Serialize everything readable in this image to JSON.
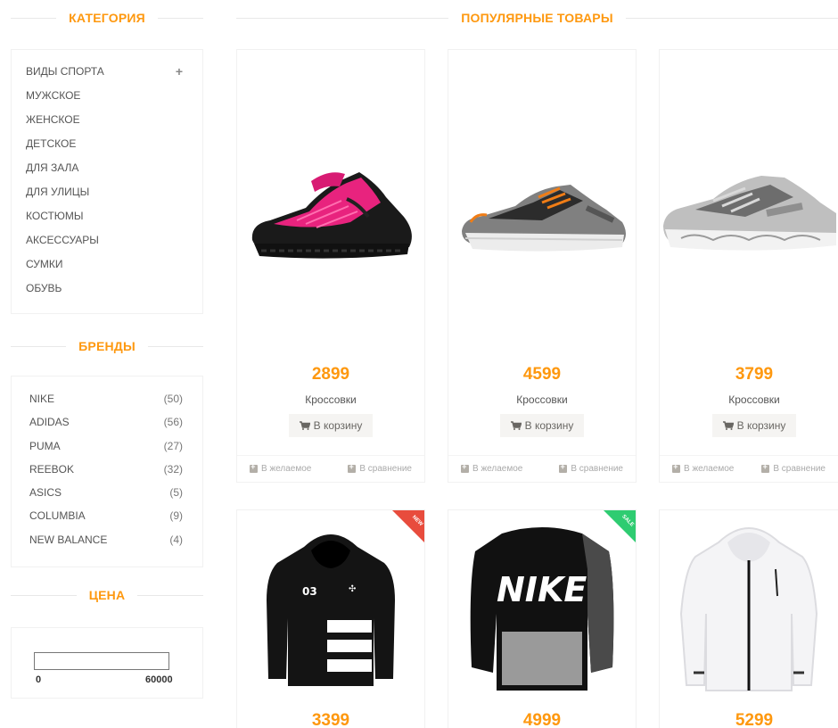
{
  "sidebar": {
    "category_title": "КАТЕГОРИЯ",
    "categories": [
      "ВИДЫ СПОРТА",
      "МУЖСКОЕ",
      "ЖЕНСКОЕ",
      "ДЕТСКОЕ",
      "ДЛЯ ЗАЛА",
      "ДЛЯ УЛИЦЫ",
      "КОСТЮМЫ",
      "АКСЕССУАРЫ",
      "СУМКИ",
      "ОБУВЬ"
    ],
    "expand_symbol": "+",
    "brands_title": "БРЕНДЫ",
    "brands": [
      {
        "name": "NIKE",
        "count": "(50)"
      },
      {
        "name": "ADIDAS",
        "count": "(56)"
      },
      {
        "name": "PUMA",
        "count": "(27)"
      },
      {
        "name": "REEBOK",
        "count": "(32)"
      },
      {
        "name": "ASICS",
        "count": "(5)"
      },
      {
        "name": "COLUMBIA",
        "count": "(9)"
      },
      {
        "name": "NEW BALANCE",
        "count": "(4)"
      }
    ],
    "price_title": "ЦЕНА",
    "price_min": "0",
    "price_max": "60000"
  },
  "main": {
    "title": "ПОПУЛЯРНЫЕ ТОВАРЫ",
    "products": [
      {
        "price": "2899",
        "name": "Кроссовки",
        "cart": "В корзину",
        "wish": "В желаемое",
        "compare": "В сравнение",
        "image": "sneaker-pink-black"
      },
      {
        "price": "4599",
        "name": "Кроссовки",
        "cart": "В корзину",
        "wish": "В желаемое",
        "compare": "В сравнение",
        "image": "sneaker-grey-orange"
      },
      {
        "price": "3799",
        "name": "Кроссовки",
        "cart": "В корзину",
        "wish": "В желаемое",
        "compare": "В сравнение",
        "image": "sneaker-silver"
      },
      {
        "price": "3399",
        "badge": "NEW",
        "image": "hoodie-black-adidas"
      },
      {
        "price": "4999",
        "badge": "SALE",
        "image": "sweatshirt-nike"
      },
      {
        "price": "5299",
        "image": "jacket-white"
      }
    ]
  },
  "colors": {
    "accent": "#fe980f",
    "new_badge": "#e84c3d",
    "sale_badge": "#2ecc71"
  }
}
